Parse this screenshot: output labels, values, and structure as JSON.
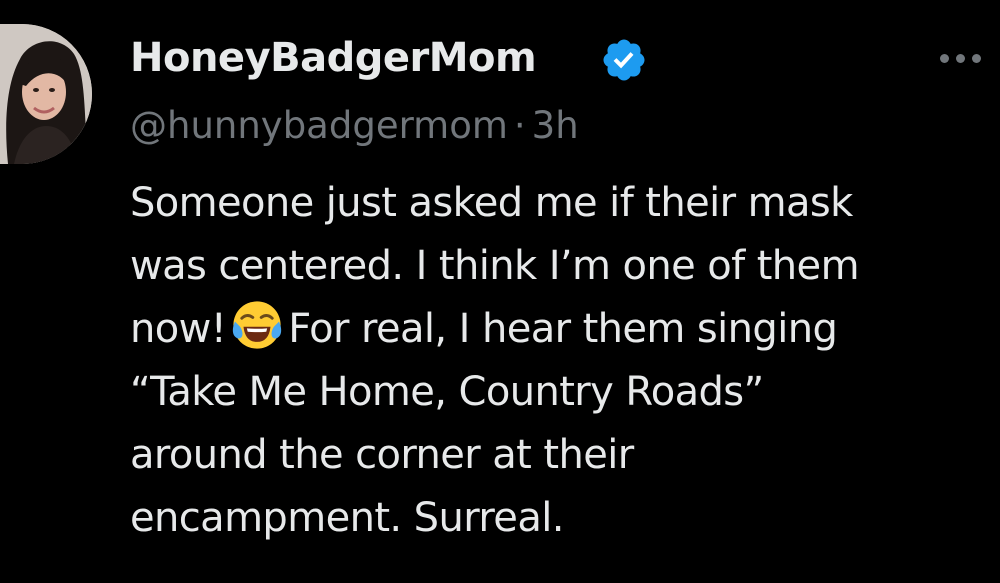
{
  "author": {
    "display_name": "HoneyBadgerMom",
    "handle": "@hunnybadgermom",
    "separator": "·",
    "time_ago": "3h",
    "verified": true
  },
  "icons": {
    "avatar": "profile-photo",
    "verified": "verified-badge-icon",
    "more": "more-options-icon",
    "emoji": "face-with-tears-of-joy"
  },
  "colors": {
    "background": "#000000",
    "primary_text": "#e7e9ea",
    "secondary_text": "#71767b",
    "verified_blue": "#1d9bf0"
  },
  "tweet": {
    "line1": "Someone just asked me if their mask",
    "line2": "was centered. I think I’m one of them",
    "line3_start": "now!",
    "line3_end": "For real, I hear them singing",
    "line4": "“Take Me Home, Country Roads”",
    "line5": "around the corner at their",
    "line6": "encampment. Surreal."
  }
}
